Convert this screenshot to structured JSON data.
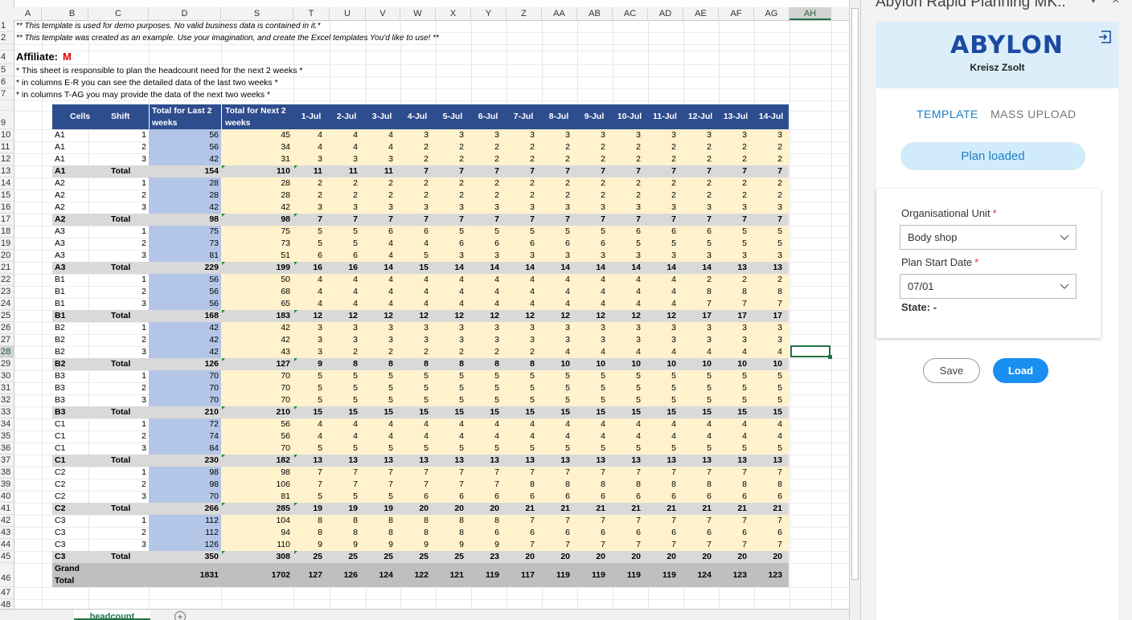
{
  "column_letters": [
    "A",
    "B",
    "C",
    "D",
    "S",
    "T",
    "U",
    "V",
    "W",
    "X",
    "Y",
    "Z",
    "AA",
    "AB",
    "AC",
    "AD",
    "AE",
    "AF",
    "AG",
    "AH"
  ],
  "selected_column": "AH",
  "row_numbers": [
    "1",
    "2",
    "",
    "4",
    "5",
    "6",
    "7",
    "",
    "9",
    "10",
    "11",
    "12",
    "13",
    "14",
    "15",
    "16",
    "17",
    "18",
    "19",
    "20",
    "21",
    "22",
    "23",
    "24",
    "25",
    "26",
    "27",
    "28",
    "29",
    "30",
    "31",
    "32",
    "33",
    "34",
    "35",
    "36",
    "37",
    "38",
    "39",
    "40",
    "41",
    "42",
    "43",
    "44",
    "45",
    "46",
    "47",
    "48"
  ],
  "selected_row": "28",
  "notes": {
    "line1": "** This template is used for demo purposes. No valid business data is contained in it.*",
    "line2": "** This template was created as an example. Use your imagination, and create the Excel templates You'd like to use! **",
    "affiliate_label": "Affiliate:",
    "affiliate_value": "M",
    "line5": "* This sheet is responsible to plan the headcount need for the next 2 weeks *",
    "line6": "* in columns E-R you can see the detailed data of the last two weeks *",
    "line7": "* in columns T-AG you may provide the data of the next two weeks *"
  },
  "table": {
    "headers": {
      "cells": "Cells",
      "shift": "Shift",
      "last2": "Total for Last 2 weeks",
      "next2": "Total for Next 2 weeks",
      "days": [
        "1-Jul",
        "2-Jul",
        "3-Jul",
        "4-Jul",
        "5-Jul",
        "6-Jul",
        "7-Jul",
        "8-Jul",
        "9-Jul",
        "10-Jul",
        "11-Jul",
        "12-Jul",
        "13-Jul",
        "14-Jul"
      ]
    },
    "rows": [
      {
        "cell": "A1",
        "shift": "1",
        "last2": "56",
        "next2": "45",
        "days": [
          "4",
          "4",
          "4",
          "3",
          "3",
          "3",
          "3",
          "3",
          "3",
          "3",
          "3",
          "3",
          "3",
          "3"
        ]
      },
      {
        "cell": "A1",
        "shift": "2",
        "last2": "56",
        "next2": "34",
        "days": [
          "4",
          "4",
          "4",
          "2",
          "2",
          "2",
          "2",
          "2",
          "2",
          "2",
          "2",
          "2",
          "2",
          "2"
        ]
      },
      {
        "cell": "A1",
        "shift": "3",
        "last2": "42",
        "next2": "31",
        "days": [
          "3",
          "3",
          "3",
          "2",
          "2",
          "2",
          "2",
          "2",
          "2",
          "2",
          "2",
          "2",
          "2",
          "2"
        ]
      },
      {
        "cell": "A1",
        "shift": "Total",
        "total": true,
        "last2": "154",
        "next2": "110",
        "days": [
          "11",
          "11",
          "11",
          "7",
          "7",
          "7",
          "7",
          "7",
          "7",
          "7",
          "7",
          "7",
          "7",
          "7"
        ]
      },
      {
        "cell": "A2",
        "shift": "1",
        "last2": "28",
        "next2": "28",
        "days": [
          "2",
          "2",
          "2",
          "2",
          "2",
          "2",
          "2",
          "2",
          "2",
          "2",
          "2",
          "2",
          "2",
          "2"
        ]
      },
      {
        "cell": "A2",
        "shift": "2",
        "last2": "28",
        "next2": "28",
        "days": [
          "2",
          "2",
          "2",
          "2",
          "2",
          "2",
          "2",
          "2",
          "2",
          "2",
          "2",
          "2",
          "2",
          "2"
        ]
      },
      {
        "cell": "A2",
        "shift": "3",
        "last2": "42",
        "next2": "42",
        "days": [
          "3",
          "3",
          "3",
          "3",
          "3",
          "3",
          "3",
          "3",
          "3",
          "3",
          "3",
          "3",
          "3",
          "3"
        ]
      },
      {
        "cell": "A2",
        "shift": "Total",
        "total": true,
        "last2": "98",
        "next2": "98",
        "days": [
          "7",
          "7",
          "7",
          "7",
          "7",
          "7",
          "7",
          "7",
          "7",
          "7",
          "7",
          "7",
          "7",
          "7"
        ]
      },
      {
        "cell": "A3",
        "shift": "1",
        "last2": "75",
        "next2": "75",
        "days": [
          "5",
          "5",
          "6",
          "6",
          "5",
          "5",
          "5",
          "5",
          "5",
          "6",
          "6",
          "6",
          "5",
          "5"
        ]
      },
      {
        "cell": "A3",
        "shift": "2",
        "last2": "73",
        "next2": "73",
        "days": [
          "5",
          "5",
          "4",
          "4",
          "6",
          "6",
          "6",
          "6",
          "6",
          "5",
          "5",
          "5",
          "5",
          "5"
        ]
      },
      {
        "cell": "A3",
        "shift": "3",
        "last2": "81",
        "next2": "51",
        "days": [
          "6",
          "6",
          "4",
          "5",
          "3",
          "3",
          "3",
          "3",
          "3",
          "3",
          "3",
          "3",
          "3",
          "3"
        ]
      },
      {
        "cell": "A3",
        "shift": "Total",
        "total": true,
        "last2": "229",
        "next2": "199",
        "days": [
          "16",
          "16",
          "14",
          "15",
          "14",
          "14",
          "14",
          "14",
          "14",
          "14",
          "14",
          "14",
          "13",
          "13"
        ]
      },
      {
        "cell": "B1",
        "shift": "1",
        "last2": "56",
        "next2": "50",
        "days": [
          "4",
          "4",
          "4",
          "4",
          "4",
          "4",
          "4",
          "4",
          "4",
          "4",
          "4",
          "2",
          "2",
          "2"
        ]
      },
      {
        "cell": "B1",
        "shift": "2",
        "last2": "56",
        "next2": "68",
        "days": [
          "4",
          "4",
          "4",
          "4",
          "4",
          "4",
          "4",
          "4",
          "4",
          "4",
          "4",
          "8",
          "8",
          "8"
        ]
      },
      {
        "cell": "B1",
        "shift": "3",
        "last2": "56",
        "next2": "65",
        "days": [
          "4",
          "4",
          "4",
          "4",
          "4",
          "4",
          "4",
          "4",
          "4",
          "4",
          "4",
          "7",
          "7",
          "7"
        ]
      },
      {
        "cell": "B1",
        "shift": "Total",
        "total": true,
        "last2": "168",
        "next2": "183",
        "days": [
          "12",
          "12",
          "12",
          "12",
          "12",
          "12",
          "12",
          "12",
          "12",
          "12",
          "12",
          "17",
          "17",
          "17"
        ]
      },
      {
        "cell": "B2",
        "shift": "1",
        "last2": "42",
        "next2": "42",
        "days": [
          "3",
          "3",
          "3",
          "3",
          "3",
          "3",
          "3",
          "3",
          "3",
          "3",
          "3",
          "3",
          "3",
          "3"
        ]
      },
      {
        "cell": "B2",
        "shift": "2",
        "last2": "42",
        "next2": "42",
        "days": [
          "3",
          "3",
          "3",
          "3",
          "3",
          "3",
          "3",
          "3",
          "3",
          "3",
          "3",
          "3",
          "3",
          "3"
        ]
      },
      {
        "cell": "B2",
        "shift": "3",
        "last2": "42",
        "next2": "43",
        "days": [
          "3",
          "2",
          "2",
          "2",
          "2",
          "2",
          "2",
          "4",
          "4",
          "4",
          "4",
          "4",
          "4",
          "4"
        ]
      },
      {
        "cell": "B2",
        "shift": "Total",
        "total": true,
        "last2": "126",
        "next2": "127",
        "days": [
          "9",
          "8",
          "8",
          "8",
          "8",
          "8",
          "8",
          "10",
          "10",
          "10",
          "10",
          "10",
          "10",
          "10"
        ]
      },
      {
        "cell": "B3",
        "shift": "1",
        "last2": "70",
        "next2": "70",
        "days": [
          "5",
          "5",
          "5",
          "5",
          "5",
          "5",
          "5",
          "5",
          "5",
          "5",
          "5",
          "5",
          "5",
          "5"
        ]
      },
      {
        "cell": "B3",
        "shift": "2",
        "last2": "70",
        "next2": "70",
        "days": [
          "5",
          "5",
          "5",
          "5",
          "5",
          "5",
          "5",
          "5",
          "5",
          "5",
          "5",
          "5",
          "5",
          "5"
        ]
      },
      {
        "cell": "B3",
        "shift": "3",
        "last2": "70",
        "next2": "70",
        "days": [
          "5",
          "5",
          "5",
          "5",
          "5",
          "5",
          "5",
          "5",
          "5",
          "5",
          "5",
          "5",
          "5",
          "5"
        ]
      },
      {
        "cell": "B3",
        "shift": "Total",
        "total": true,
        "last2": "210",
        "next2": "210",
        "days": [
          "15",
          "15",
          "15",
          "15",
          "15",
          "15",
          "15",
          "15",
          "15",
          "15",
          "15",
          "15",
          "15",
          "15"
        ]
      },
      {
        "cell": "C1",
        "shift": "1",
        "last2": "72",
        "next2": "56",
        "days": [
          "4",
          "4",
          "4",
          "4",
          "4",
          "4",
          "4",
          "4",
          "4",
          "4",
          "4",
          "4",
          "4",
          "4"
        ]
      },
      {
        "cell": "C1",
        "shift": "2",
        "last2": "74",
        "next2": "56",
        "days": [
          "4",
          "4",
          "4",
          "4",
          "4",
          "4",
          "4",
          "4",
          "4",
          "4",
          "4",
          "4",
          "4",
          "4"
        ]
      },
      {
        "cell": "C1",
        "shift": "3",
        "last2": "84",
        "next2": "70",
        "days": [
          "5",
          "5",
          "5",
          "5",
          "5",
          "5",
          "5",
          "5",
          "5",
          "5",
          "5",
          "5",
          "5",
          "5"
        ]
      },
      {
        "cell": "C1",
        "shift": "Total",
        "total": true,
        "last2": "230",
        "next2": "182",
        "days": [
          "13",
          "13",
          "13",
          "13",
          "13",
          "13",
          "13",
          "13",
          "13",
          "13",
          "13",
          "13",
          "13",
          "13"
        ]
      },
      {
        "cell": "C2",
        "shift": "1",
        "last2": "98",
        "next2": "98",
        "days": [
          "7",
          "7",
          "7",
          "7",
          "7",
          "7",
          "7",
          "7",
          "7",
          "7",
          "7",
          "7",
          "7",
          "7"
        ]
      },
      {
        "cell": "C2",
        "shift": "2",
        "last2": "98",
        "next2": "106",
        "days": [
          "7",
          "7",
          "7",
          "7",
          "7",
          "7",
          "8",
          "8",
          "8",
          "8",
          "8",
          "8",
          "8",
          "8"
        ]
      },
      {
        "cell": "C2",
        "shift": "3",
        "last2": "70",
        "next2": "81",
        "days": [
          "5",
          "5",
          "5",
          "6",
          "6",
          "6",
          "6",
          "6",
          "6",
          "6",
          "6",
          "6",
          "6",
          "6"
        ]
      },
      {
        "cell": "C2",
        "shift": "Total",
        "total": true,
        "last2": "266",
        "next2": "285",
        "days": [
          "19",
          "19",
          "19",
          "20",
          "20",
          "20",
          "21",
          "21",
          "21",
          "21",
          "21",
          "21",
          "21",
          "21"
        ]
      },
      {
        "cell": "C3",
        "shift": "1",
        "last2": "112",
        "next2": "104",
        "days": [
          "8",
          "8",
          "8",
          "8",
          "8",
          "8",
          "7",
          "7",
          "7",
          "7",
          "7",
          "7",
          "7",
          "7"
        ]
      },
      {
        "cell": "C3",
        "shift": "2",
        "last2": "112",
        "next2": "94",
        "days": [
          "8",
          "8",
          "8",
          "8",
          "8",
          "6",
          "6",
          "6",
          "6",
          "6",
          "6",
          "6",
          "6",
          "6"
        ]
      },
      {
        "cell": "C3",
        "shift": "3",
        "last2": "126",
        "next2": "110",
        "days": [
          "9",
          "9",
          "9",
          "9",
          "9",
          "9",
          "7",
          "7",
          "7",
          "7",
          "7",
          "7",
          "7",
          "7"
        ]
      },
      {
        "cell": "C3",
        "shift": "Total",
        "total": true,
        "last2": "350",
        "next2": "308",
        "days": [
          "25",
          "25",
          "25",
          "25",
          "25",
          "23",
          "20",
          "20",
          "20",
          "20",
          "20",
          "20",
          "20",
          "20"
        ]
      }
    ],
    "grand": {
      "label": "Grand Total",
      "last2": "1831",
      "next2": "1702",
      "days": [
        "127",
        "126",
        "124",
        "122",
        "121",
        "119",
        "117",
        "119",
        "119",
        "119",
        "119",
        "124",
        "123",
        "123"
      ]
    }
  },
  "sheet_tab": "headcount",
  "add_sheet": "+",
  "pane": {
    "title": "Abylon Rapid Planning MK..",
    "logo": "ABYLON",
    "user": "Kreisz Zsolt",
    "tabs": [
      "TEMPLATE",
      "MASS UPLOAD"
    ],
    "status": "Plan loaded",
    "org_unit_label": "Organisational Unit",
    "org_unit_value": "Body shop",
    "start_label": "Plan Start Date",
    "start_value": "07/01",
    "required_mark": "*",
    "state": "State: -",
    "save": "Save",
    "load": "Load"
  }
}
